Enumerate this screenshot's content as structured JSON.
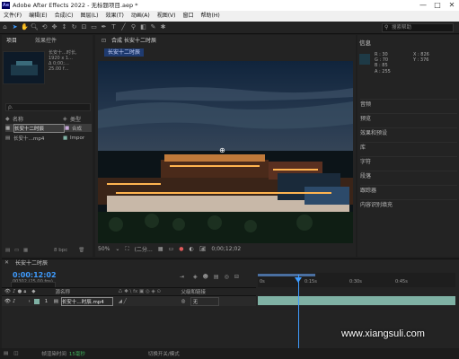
{
  "window": {
    "title": "Adobe After Effects 2022 - 无标题项目.aep *",
    "app_badge": "Ae",
    "controls": [
      "—",
      "□",
      "✕"
    ]
  },
  "menu": [
    "文件(F)",
    "编辑(E)",
    "合成(C)",
    "图层(L)",
    "效果(T)",
    "动画(A)",
    "视图(V)",
    "窗口",
    "帮助(H)"
  ],
  "search": {
    "placeholder": "搜索帮助"
  },
  "project": {
    "tab_project": "项目",
    "tab_effects": "效果控件",
    "info_lines": [
      "长安十…时长,",
      "1920 x 1…",
      "Δ 0;00;…",
      "25.00 f…"
    ],
    "search_placeholder": "ρ.",
    "col_name": "名称",
    "col_type": "类型",
    "items": [
      {
        "name": "长安十二时辰",
        "type": "合成"
      },
      {
        "name": "长安十…mp4",
        "type": "Impor"
      }
    ],
    "bpc": "8 bpc"
  },
  "composition": {
    "tab": "合成 长安十二时辰",
    "label": "长安十二时辰",
    "zoom": "50%",
    "resolution": "(二分…",
    "timecode": "0;00;12;02"
  },
  "info": {
    "title": "信息",
    "rgba": [
      "R : 30",
      "G : 70",
      "B : 85",
      "A : 255"
    ],
    "xy": [
      "X : 826",
      "Y : 376"
    ],
    "sections": [
      "音频",
      "预览",
      "效果和预设",
      "库",
      "字符",
      "段落",
      "跟踪器",
      "内容识别填充"
    ]
  },
  "timeline": {
    "tab": "长安十二时辰",
    "time": "0:00:12:02",
    "frames": "00302 (25.00 fps)",
    "col_source": "源名称",
    "col_parent": "父级和链接",
    "layer_index": "1",
    "layer_name": "长安十…时辰.mp4",
    "layer_parent": "无",
    "ruler_ticks": [
      "0s",
      "0:15s",
      "0:30s",
      "0:45s"
    ]
  },
  "status": {
    "render_time": "帧渲染时间",
    "render_value": "15毫秒",
    "toggle": "切换开关/模式"
  },
  "watermark": "www.xiangsuli.com",
  "colors": {
    "accent": "#3f9cff",
    "track": "#7fb1a4",
    "label": "#1f3b70"
  }
}
